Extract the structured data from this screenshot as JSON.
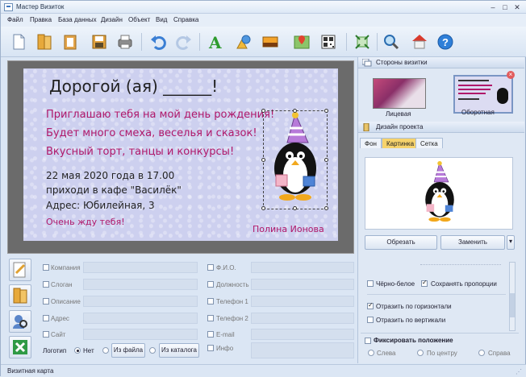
{
  "window": {
    "title": "Мастер Визиток"
  },
  "menu": [
    "Файл",
    "Правка",
    "База данных",
    "Дизайн",
    "Объект",
    "Вид",
    "Справка"
  ],
  "toolbar_icons": [
    "new-file-icon",
    "open-folder-icon",
    "paste-icon",
    "save-icon",
    "print-icon",
    "undo-icon",
    "redo-icon",
    "text-icon",
    "shapes-icon",
    "image-icon",
    "map-icon",
    "qr-code-icon",
    "fit-icon",
    "zoom-icon",
    "home-icon",
    "help-icon"
  ],
  "card": {
    "greeting": "Дорогой (ая) ______!",
    "line1": "Приглашаю тебя на мой день рождения!",
    "line2": "Будет много смеха, веселья и сказок!",
    "line3": "Вкусный торт, танцы и конкурсы!",
    "date": "22 мая 2020 года в 17.00",
    "place": "приходи в кафе \"Василёк\"",
    "address": "Адрес: Юбилейная, 3",
    "wait": "Очень жду тебя!",
    "signature": "Полина Ионова",
    "colors": {
      "title": "#111111",
      "pink": "#b0186a",
      "dark": "#1a1a1a"
    }
  },
  "right": {
    "sides_header": "Стороны визитки",
    "front_label": "Лицевая",
    "back_label": "Оборотная",
    "design_header": "Дизайн проекта",
    "tabs": [
      "Фон",
      "Картинка",
      "Сетка"
    ],
    "crop_button": "Обрезать",
    "replace_button": "Заменить",
    "bw": "Чёрно-белое",
    "keep_ratio": "Сохранять пропорции",
    "flip_h": "Отразить по горизонтали",
    "flip_v": "Отразить по вертикали",
    "fix_position": "Фиксировать положение",
    "align": [
      "Слева",
      "По центру",
      "Справа"
    ]
  },
  "fields": {
    "left": [
      "Компания",
      "Слоган",
      "Описание",
      "Адрес",
      "Сайт"
    ],
    "right": [
      "Ф.И.О.",
      "Должность",
      "Телефон 1",
      "Телефон 2",
      "E-mail",
      "Инфо"
    ],
    "logo_label": "Логотип",
    "logo_none": "Нет",
    "from_file": "Из файла",
    "from_catalog": "Из каталога"
  },
  "status": "Визитная карта"
}
